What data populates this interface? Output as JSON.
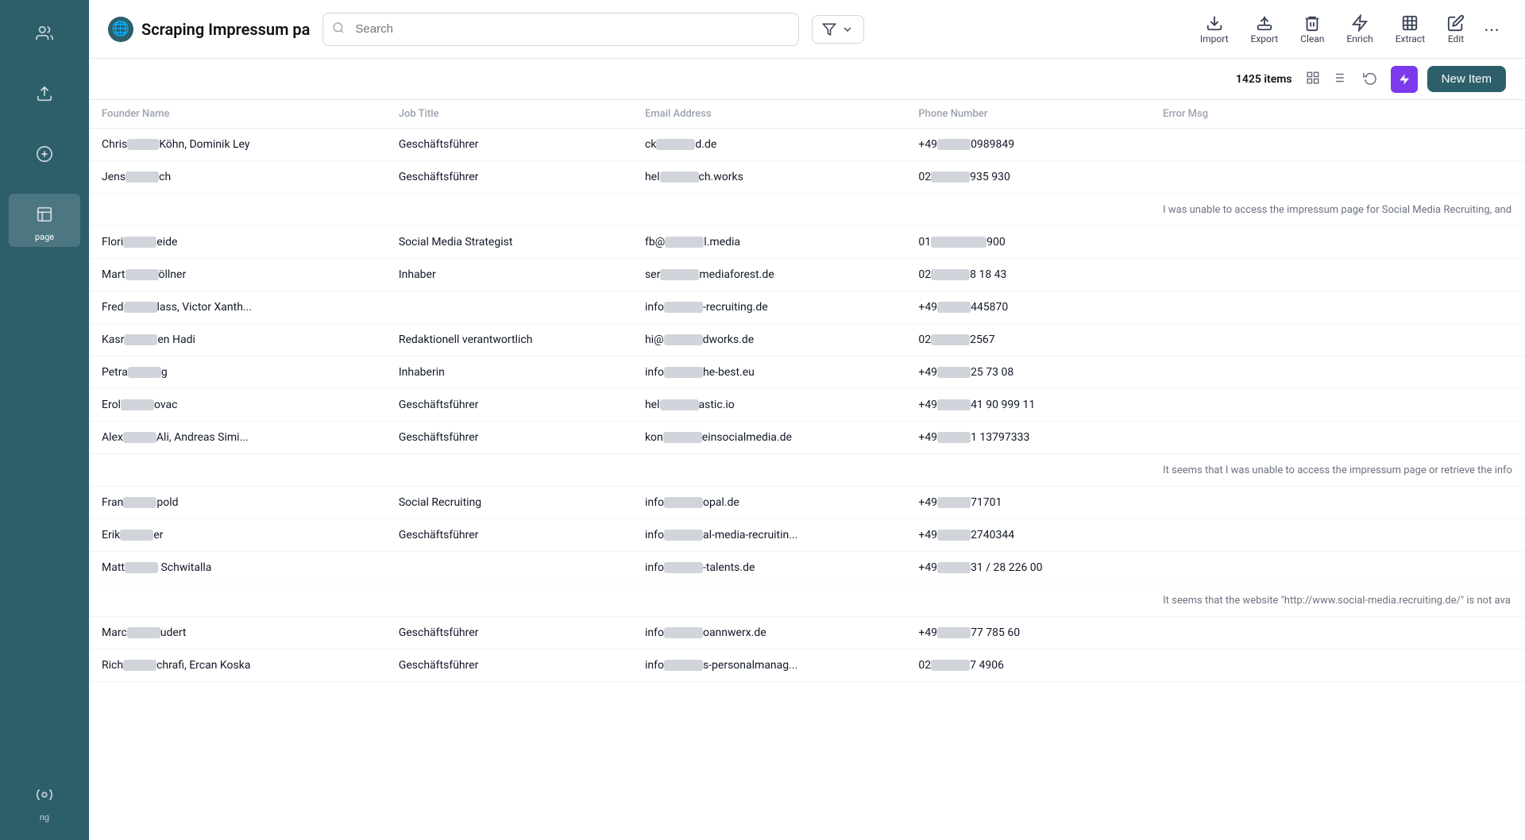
{
  "sidebar": {
    "items": [
      {
        "id": "people",
        "label": "",
        "icon": "people"
      },
      {
        "id": "upload",
        "label": "",
        "icon": "upload"
      },
      {
        "id": "add",
        "label": "",
        "icon": "add"
      },
      {
        "id": "page",
        "label": "page",
        "icon": "page",
        "active": true
      },
      {
        "id": "ng",
        "label": "ng",
        "icon": "ng"
      }
    ]
  },
  "topbar": {
    "title": "Scraping Impressum pa",
    "search_placeholder": "Search",
    "filter_label": ""
  },
  "toolbar": {
    "import": "Import",
    "export": "Export",
    "clean": "Clean",
    "enrich": "Enrich",
    "extract": "Extract",
    "edit": "Edit"
  },
  "actionbar": {
    "items_count": "1425 items",
    "new_item": "New Item"
  },
  "table": {
    "columns": [
      "Founder Name",
      "Job Title",
      "Email Address",
      "Phone Number",
      "Error Msg"
    ],
    "rows": [
      {
        "founder": "Chris___Köhn, Dominik Ley",
        "founder_blur": true,
        "job": "Geschäftsführer",
        "email": "ck_______d.de",
        "email_blur": true,
        "phone": "+49______0989849",
        "phone_blur": true,
        "error": ""
      },
      {
        "founder": "Jens______ch",
        "founder_blur": true,
        "job": "Geschäftsführer",
        "email": "hel_______ch.works",
        "email_blur": true,
        "phone": "02_______935 930",
        "phone_blur": true,
        "error": ""
      },
      {
        "founder": "",
        "job": "",
        "email": "",
        "phone": "",
        "error": "I was unable to access the impressum page for Social Media Recruiting, and"
      },
      {
        "founder": "Flori______eide",
        "founder_blur": true,
        "job": "Social Media Strategist",
        "email": "fb@_______l.media",
        "email_blur": true,
        "phone": "01__________900",
        "phone_blur": true,
        "error": ""
      },
      {
        "founder": "Mart______öllner",
        "founder_blur": true,
        "job": "Inhaber",
        "email": "ser_______mediaforest.de",
        "email_blur": true,
        "phone": "02_______8 18 43",
        "phone_blur": true,
        "error": ""
      },
      {
        "founder": "Fred______lass, Victor Xanth...",
        "founder_blur": true,
        "job": "",
        "email": "info_______-recruiting.de",
        "email_blur": true,
        "phone": "+49______445870",
        "phone_blur": true,
        "error": ""
      },
      {
        "founder": "Kasr______en Hadi",
        "founder_blur": true,
        "job": "Redaktionell verantwortlich",
        "email": "hi@_______dworks.de",
        "email_blur": true,
        "phone": "02_______2567",
        "phone_blur": true,
        "error": ""
      },
      {
        "founder": "Petra______g",
        "founder_blur": true,
        "job": "Inhaberin",
        "email": "info_______he-best.eu",
        "email_blur": true,
        "phone": "+49______25 73 08",
        "phone_blur": true,
        "error": ""
      },
      {
        "founder": "Erol______ovac",
        "founder_blur": true,
        "job": "Geschäftsführer",
        "email": "hel_______astic.io",
        "email_blur": true,
        "phone": "+49______41 90 999 11",
        "phone_blur": true,
        "error": ""
      },
      {
        "founder": "Alex______Ali, Andreas Simi...",
        "founder_blur": true,
        "job": "Geschäftsführer",
        "email": "kon_______einsocialmedia.de",
        "email_blur": true,
        "phone": "+49______1 13797333",
        "phone_blur": true,
        "error": ""
      },
      {
        "founder": "",
        "job": "",
        "email": "",
        "phone": "",
        "error": "It seems that I was unable to access the impressum page or retrieve the info"
      },
      {
        "founder": "Fran______pold",
        "founder_blur": true,
        "job": "Social Recruiting",
        "email": "info_______opal.de",
        "email_blur": true,
        "phone": "+49______71701",
        "phone_blur": true,
        "error": ""
      },
      {
        "founder": "Erik______er",
        "founder_blur": true,
        "job": "Geschäftsführer",
        "email": "info_______al-media-recruitin...",
        "email_blur": true,
        "phone": "+49______2740344",
        "phone_blur": true,
        "error": ""
      },
      {
        "founder": "Matt______ Schwitalla",
        "founder_blur": true,
        "job": "",
        "email": "info_______-talents.de",
        "email_blur": true,
        "phone": "+49______31 / 28 226 00",
        "phone_blur": true,
        "error": ""
      },
      {
        "founder": "",
        "job": "",
        "email": "",
        "phone": "",
        "error": "It seems that the website \"http://www.social-media.recruiting.de/\" is not ava"
      },
      {
        "founder": "Marc______udert",
        "founder_blur": true,
        "job": "Geschäftsführer",
        "email": "info_______oannwerx.de",
        "email_blur": true,
        "phone": "+49______77 785 60",
        "phone_blur": true,
        "error": ""
      },
      {
        "founder": "Rich______chrafi, Ercan Koska",
        "founder_blur": true,
        "job": "Geschäftsführer",
        "email": "info_______s-personalmanag...",
        "email_blur": true,
        "phone": "02_______7 4906",
        "phone_blur": true,
        "error": ""
      }
    ]
  }
}
